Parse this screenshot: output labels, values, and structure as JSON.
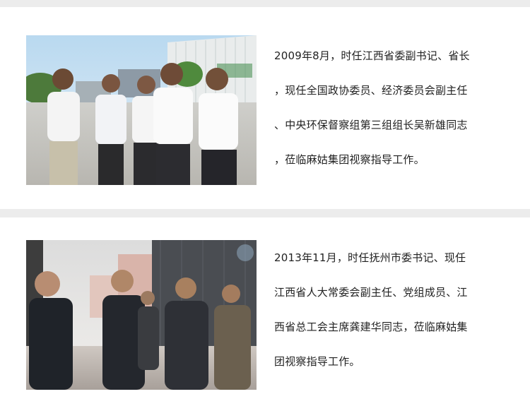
{
  "sections": [
    {
      "lines": [
        "2009年8月，时任江西省委副书记、省长",
        "，现任全国政协委员、经济委员会副主任",
        "、中央环保督察组第三组组长吴新雄同志",
        "，莅临麻姑集团视察指导工作。"
      ]
    },
    {
      "lines": [
        "2013年11月，时任抚州市委书记、现任",
        "江西省人大常委会副主任、党组成员、江",
        "西省总工会主席龚建华同志，莅临麻姑集",
        "团视察指导工作。"
      ]
    }
  ]
}
